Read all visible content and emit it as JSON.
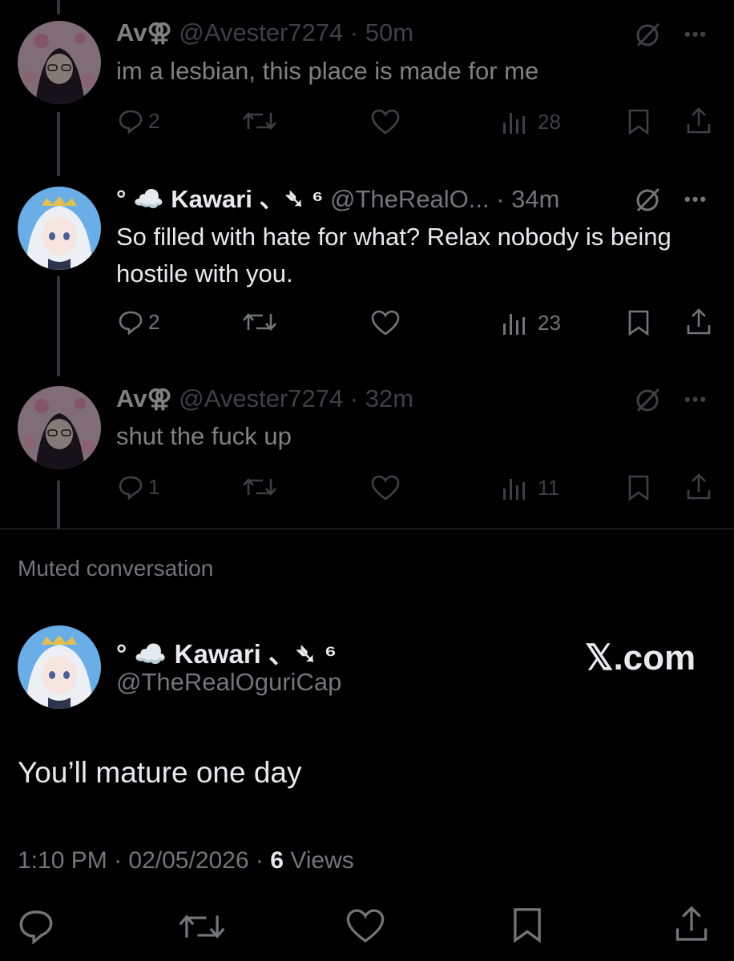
{
  "replies": [
    {
      "display_name": "Av⚢",
      "handle": "@Avester7274",
      "time": "50m",
      "text": "im a lesbian, this place is made for me",
      "replies_count": "2",
      "views": "28",
      "avatar": "pink-anime-avatar"
    },
    {
      "display_name": "° ☁️ Kawari 、➴ ⁶",
      "handle": "@TheRealO...",
      "time": "34m",
      "text": "So filled with hate for what? Relax nobody is being hostile with you.",
      "replies_count": "2",
      "views": "23",
      "avatar": "white-hair-anime-avatar"
    },
    {
      "display_name": "Av⚢",
      "handle": "@Avester7274",
      "time": "32m",
      "text": "shut the fuck up",
      "replies_count": "1",
      "views": "11",
      "avatar": "pink-anime-avatar"
    }
  ],
  "muted_label": "Muted conversation",
  "main_post": {
    "display_name": "° ☁️ Kawari 、➴ ⁶",
    "handle": "@TheRealOguriCap",
    "watermark": "𝕏.com",
    "text": "You’ll mature one day",
    "time": "1:10 PM",
    "date": "02/05/2026",
    "views_count": "6",
    "views_label": "Views"
  },
  "colors": {
    "background": "#000000",
    "text": "#e7e9ea",
    "secondary": "#71767b",
    "thread_line": "#333639"
  }
}
